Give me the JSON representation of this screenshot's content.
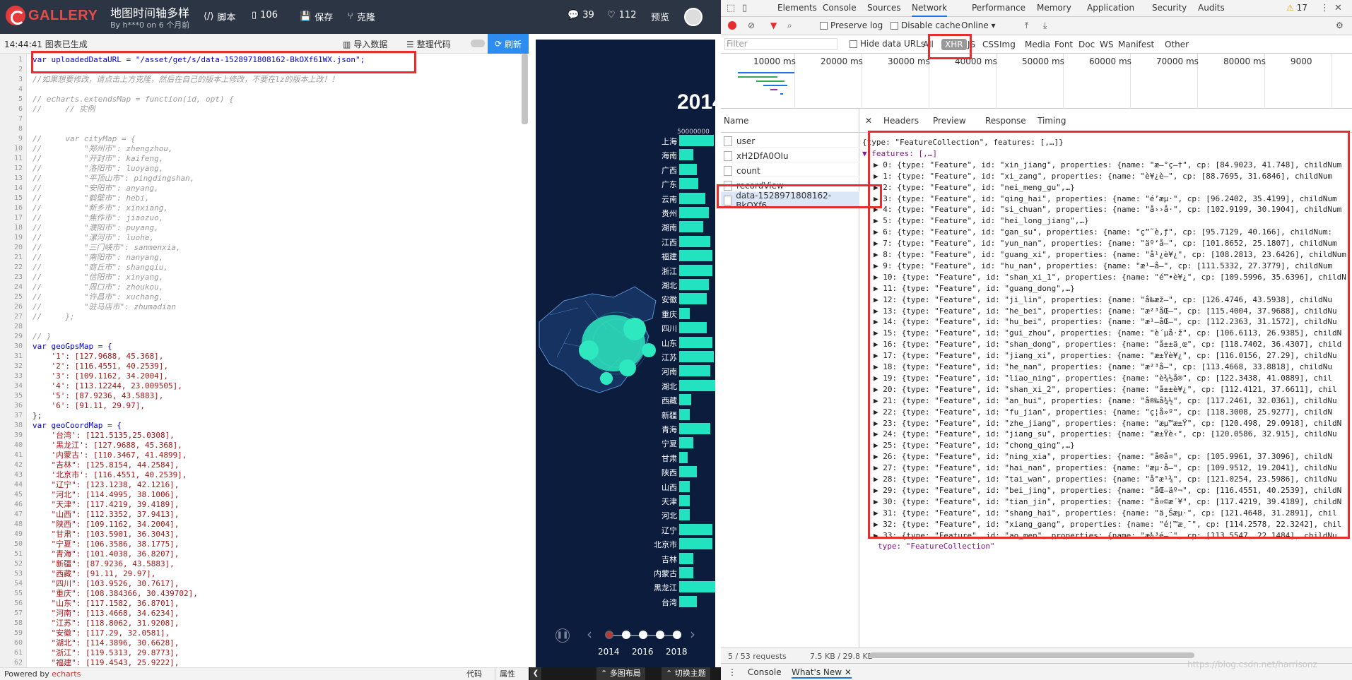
{
  "gallery": {
    "logo_text": "GALLERY",
    "page_title": "地图时间轴多样",
    "author": "By h***0 on 6 个月前",
    "script_btn": "脚本",
    "count_btn": "106",
    "save_btn": "保存",
    "clone_btn": "克隆",
    "comments": "39",
    "likes": "112",
    "preview_btn": "预览",
    "status": "14:44:41   图表已生成",
    "import_btn": "导入数据",
    "format_btn": "整理代码",
    "refresh_btn": "刷新",
    "footer_powered": "Powered by ",
    "footer_lib": "echarts",
    "tab_code": "代码",
    "tab_attr": "属性",
    "layout_btn": "多图布局",
    "theme_btn": "切换主题"
  },
  "code_lines": [
    {
      "n": "1",
      "t": "var uploadedDataURL = \"/asset/get/s/data-1528971808162-BkOXf61WX.json\";",
      "c": "kw"
    },
    {
      "n": "2",
      "t": "",
      "c": ""
    },
    {
      "n": "3",
      "t": "//如果想要修改，请点击上方克隆，然后在自己的版本上修改，不要在lz的版本上改！！",
      "c": "cm"
    },
    {
      "n": "4",
      "t": "",
      "c": ""
    },
    {
      "n": "5",
      "t": "// echarts.extendsMap = function(id, opt) {",
      "c": "cm"
    },
    {
      "n": "6",
      "t": "//     // 实例",
      "c": "cm"
    },
    {
      "n": "7",
      "t": "",
      "c": ""
    },
    {
      "n": "8",
      "t": "",
      "c": ""
    },
    {
      "n": "9",
      "t": "//     var cityMap = {",
      "c": "cm"
    },
    {
      "n": "10",
      "t": "//         \"郑州市\": zhengzhou,",
      "c": "cm"
    },
    {
      "n": "11",
      "t": "//         \"开封市\": kaifeng,",
      "c": "cm"
    },
    {
      "n": "12",
      "t": "//         \"洛阳市\": luoyang,",
      "c": "cm"
    },
    {
      "n": "13",
      "t": "//         \"平顶山市\": pingdingshan,",
      "c": "cm"
    },
    {
      "n": "14",
      "t": "//         \"安阳市\": anyang,",
      "c": "cm"
    },
    {
      "n": "15",
      "t": "//         \"鹤壁市\": hebi,",
      "c": "cm"
    },
    {
      "n": "16",
      "t": "//         \"新乡市\": xinxiang,",
      "c": "cm"
    },
    {
      "n": "17",
      "t": "//         \"焦作市\": jiaozuo,",
      "c": "cm"
    },
    {
      "n": "18",
      "t": "//         \"濮阳市\": puyang,",
      "c": "cm"
    },
    {
      "n": "19",
      "t": "//         \"漯河市\": luohe,",
      "c": "cm"
    },
    {
      "n": "20",
      "t": "//         \"三门峡市\": sanmenxia,",
      "c": "cm"
    },
    {
      "n": "21",
      "t": "//         \"南阳市\": nanyang,",
      "c": "cm"
    },
    {
      "n": "22",
      "t": "//         \"商丘市\": shangqiu,",
      "c": "cm"
    },
    {
      "n": "23",
      "t": "//         \"信阳市\": xinyang,",
      "c": "cm"
    },
    {
      "n": "24",
      "t": "//         \"周口市\": zhoukou,",
      "c": "cm"
    },
    {
      "n": "25",
      "t": "//         \"许昌市\": xuchang,",
      "c": "cm"
    },
    {
      "n": "26",
      "t": "//         \"驻马店市\": zhumadian",
      "c": "cm"
    },
    {
      "n": "27",
      "t": "//     };",
      "c": "cm"
    },
    {
      "n": "28",
      "t": "",
      "c": ""
    },
    {
      "n": "29",
      "t": "// }",
      "c": "cm"
    },
    {
      "n": "30",
      "t": "var geoGpsMap = {",
      "c": "kw"
    },
    {
      "n": "31",
      "t": "    '1': [127.9688, 45.368],",
      "c": "str"
    },
    {
      "n": "32",
      "t": "    '2': [116.4551, 40.2539],",
      "c": "str"
    },
    {
      "n": "33",
      "t": "    '3': [109.1162, 34.2004],",
      "c": "str"
    },
    {
      "n": "34",
      "t": "    '4': [113.12244, 23.009505],",
      "c": "str"
    },
    {
      "n": "35",
      "t": "    '5': [87.9236, 43.5883],",
      "c": "str"
    },
    {
      "n": "36",
      "t": "    '6': [91.11, 29.97],",
      "c": "str"
    },
    {
      "n": "37",
      "t": "};",
      "c": ""
    },
    {
      "n": "38",
      "t": "var geoCoordMap = {",
      "c": "kw"
    },
    {
      "n": "39",
      "t": "    '台湾': [121.5135,25.0308],",
      "c": "str"
    },
    {
      "n": "40",
      "t": "    '黑龙江': [127.9688, 45.368],",
      "c": "str"
    },
    {
      "n": "41",
      "t": "    '内蒙古': [110.3467, 41.4899],",
      "c": "str"
    },
    {
      "n": "42",
      "t": "    \"吉林\": [125.8154, 44.2584],",
      "c": "str"
    },
    {
      "n": "43",
      "t": "    '北京市': [116.4551, 40.2539],",
      "c": "str"
    },
    {
      "n": "44",
      "t": "    \"辽宁\": [123.1238, 42.1216],",
      "c": "str"
    },
    {
      "n": "45",
      "t": "    \"河北\": [114.4995, 38.1006],",
      "c": "str"
    },
    {
      "n": "46",
      "t": "    \"天津\": [117.4219, 39.4189],",
      "c": "str"
    },
    {
      "n": "47",
      "t": "    \"山西\": [112.3352, 37.9413],",
      "c": "str"
    },
    {
      "n": "48",
      "t": "    \"陕西\": [109.1162, 34.2004],",
      "c": "str"
    },
    {
      "n": "49",
      "t": "    \"甘肃\": [103.5901, 36.3043],",
      "c": "str"
    },
    {
      "n": "50",
      "t": "    \"宁夏\": [106.3586, 38.1775],",
      "c": "str"
    },
    {
      "n": "51",
      "t": "    \"青海\": [101.4038, 36.8207],",
      "c": "str"
    },
    {
      "n": "52",
      "t": "    \"新疆\": [87.9236, 43.5883],",
      "c": "str"
    },
    {
      "n": "53",
      "t": "    \"西藏\": [91.11, 29.97],",
      "c": "str"
    },
    {
      "n": "54",
      "t": "    \"四川\": [103.9526, 30.7617],",
      "c": "str"
    },
    {
      "n": "55",
      "t": "    \"重庆\": [108.384366, 30.439702],",
      "c": "str"
    },
    {
      "n": "56",
      "t": "    \"山东\": [117.1582, 36.8701],",
      "c": "str"
    },
    {
      "n": "57",
      "t": "    \"河南\": [113.4668, 34.6234],",
      "c": "str"
    },
    {
      "n": "58",
      "t": "    \"江苏\": [118.8062, 31.9208],",
      "c": "str"
    },
    {
      "n": "59",
      "t": "    \"安徽\": [117.29, 32.0581],",
      "c": "str"
    },
    {
      "n": "60",
      "t": "    \"湖北\": [114.3896, 30.6628],",
      "c": "str"
    },
    {
      "n": "61",
      "t": "    \"浙江\": [119.5313, 29.8773],",
      "c": "str"
    },
    {
      "n": "62",
      "t": "    \"福建\": [119.4543, 25.9222],",
      "c": "str"
    }
  ],
  "chart": {
    "year": "2014",
    "scale": "50000000",
    "bars": [
      {
        "name": "上海",
        "value": 100
      },
      {
        "name": "海南",
        "value": 40
      },
      {
        "name": "广西",
        "value": 50
      },
      {
        "name": "广东",
        "value": 55
      },
      {
        "name": "云南",
        "value": 75
      },
      {
        "name": "贵州",
        "value": 85
      },
      {
        "name": "湖南",
        "value": 70
      },
      {
        "name": "江西",
        "value": 90
      },
      {
        "name": "福建",
        "value": 95
      },
      {
        "name": "浙江",
        "value": 95
      },
      {
        "name": "湖北",
        "value": 85
      },
      {
        "name": "安徽",
        "value": 80
      },
      {
        "name": "重庆",
        "value": 30
      },
      {
        "name": "四川",
        "value": 80
      },
      {
        "name": "山东",
        "value": 95
      },
      {
        "name": "江苏",
        "value": 100
      },
      {
        "name": "河南",
        "value": 90
      },
      {
        "name": "湖北2",
        "value": 105
      },
      {
        "name": "西藏",
        "value": 35
      },
      {
        "name": "新疆",
        "value": 30
      },
      {
        "name": "青海",
        "value": 90
      },
      {
        "name": "宁夏",
        "value": 40
      },
      {
        "name": "甘肃",
        "value": 25
      },
      {
        "name": "陕西",
        "value": 50
      },
      {
        "name": "山西",
        "value": 30
      },
      {
        "name": "天津",
        "value": 30
      },
      {
        "name": "河北",
        "value": 30
      },
      {
        "name": "辽宁",
        "value": 95
      },
      {
        "name": "北京市",
        "value": 95
      },
      {
        "name": "吉林",
        "value": 40
      },
      {
        "name": "内蒙古",
        "value": 40
      },
      {
        "name": "黑龙江",
        "value": 105
      },
      {
        "name": "台湾",
        "value": 50
      }
    ],
    "timeline_years": [
      "2014",
      "2016",
      "2018"
    ],
    "bar_color": "#22e3c0"
  },
  "devtools": {
    "tabs": [
      "Elements",
      "Console",
      "Sources",
      "Network",
      "Performance",
      "Memory",
      "Application",
      "Security",
      "Audits"
    ],
    "warn": "17",
    "preserve_log": "Preserve log",
    "disable_cache": "Disable cache",
    "online": "Online",
    "filter_placeholder": "Filter",
    "hide_data_urls": "Hide data URLs",
    "filter_types": [
      "All",
      "XHR",
      "JS",
      "CSS",
      "Img",
      "Media",
      "Font",
      "Doc",
      "WS",
      "Manifest",
      "Other"
    ],
    "timeline_ticks": [
      "10000 ms",
      "20000 ms",
      "30000 ms",
      "40000 ms",
      "50000 ms",
      "60000 ms",
      "70000 ms",
      "80000 ms",
      "9000"
    ],
    "name_header": "Name",
    "requests": [
      "user",
      "xH2DfA0OIu",
      "count",
      "recordView",
      "data-1528971808162-BkOXf6..."
    ],
    "preview_tabs": [
      "Headers",
      "Preview",
      "Response",
      "Timing"
    ],
    "status": "5 / 53 requests",
    "size": "7.5 KB / 29.8 KB",
    "drawer_console": "Console",
    "drawer_whatsnew": "What's New",
    "watermark": "https://blog.csdn.net/harrisonz"
  },
  "json_lines": [
    "{type: \"FeatureCollection\", features: [,…]}",
    "▼ features: [,…]",
    "▶ 0: {type: \"Feature\", id: \"xin_jiang\", properties: {name: \"æ–°ç–†\", cp: [84.9023, 41.748], childNum",
    "▶ 1: {type: \"Feature\", id: \"xi_zang\", properties: {name: \"è¥¿è—\", cp: [88.7695, 31.6846], childNum",
    "▶ 2: {type: \"Feature\", id: \"nei_meng_gu\",…}",
    "▶ 3: {type: \"Feature\", id: \"qing_hai\", properties: {name: \"é’æµ·\", cp: [96.2402, 35.4199], childNum",
    "▶ 4: {type: \"Feature\", id: \"si_chuan\", properties: {name: \"å››å·\", cp: [102.9199, 30.1904], childNum",
    "▶ 5: {type: \"Feature\", id: \"hei_long_jiang\",…}",
    "▶ 6: {type: \"Feature\", id: \"gan_su\", properties: {name: \"ç”˜è‚ƒ\", cp: [95.7129, 40.166], childNum:",
    "▶ 7: {type: \"Feature\", id: \"yun_nan\", properties: {name: \"äº‘å—\", cp: [101.8652, 25.1807], childNum",
    "▶ 8: {type: \"Feature\", id: \"guang_xi\", properties: {name: \"å¹¿è¥¿\", cp: [108.2813, 23.6426], childNum",
    "▶ 9: {type: \"Feature\", id: \"hu_nan\", properties: {name: \"æ¹–å—\", cp: [111.5332, 27.3779], childNum",
    "▶ 10: {type: \"Feature\", id: \"shan_xi_1\", properties: {name: \"é™•è¥¿\", cp: [109.5996, 35.6396], childN",
    "▶ 11: {type: \"Feature\", id: \"guang_dong\",…}",
    "▶ 12: {type: \"Feature\", id: \"ji_lin\", properties: {name: \"å‰æž—\", cp: [126.4746, 43.5938], childNu",
    "▶ 13: {type: \"Feature\", id: \"he_bei\", properties: {name: \"æ²³åŒ—\", cp: [115.4004, 37.9688], childNu",
    "▶ 14: {type: \"Feature\", id: \"hu_bei\", properties: {name: \"æ¹–åŒ—\", cp: [112.2363, 31.1572], childNu",
    "▶ 15: {type: \"Feature\", id: \"gui_zhou\", properties: {name: \"è´µå·ž\", cp: [106.6113, 26.9385], childN",
    "▶ 16: {type: \"Feature\", id: \"shan_dong\", properties: {name: \"å±±ä¸œ\", cp: [118.7402, 36.4307], child",
    "▶ 17: {type: \"Feature\", id: \"jiang_xi\", properties: {name: \"æ±Ÿè¥¿\", cp: [116.0156, 27.29], childNu",
    "▶ 18: {type: \"Feature\", id: \"he_nan\", properties: {name: \"æ²³å—\", cp: [113.4668, 33.8818], childNu",
    "▶ 19: {type: \"Feature\", id: \"liao_ning\", properties: {name: \"è¾½å®\", cp: [122.3438, 41.0889], chil",
    "▶ 20: {type: \"Feature\", id: \"shan_xi_2\", properties: {name: \"å±±è¥¿\", cp: [112.4121, 37.6611], chil",
    "▶ 21: {type: \"Feature\", id: \"an_hui\", properties: {name: \"å®‰å¾½\", cp: [117.2461, 32.0361], childNu",
    "▶ 22: {type: \"Feature\", id: \"fu_jian\", properties: {name: \"ç¦å»º\", cp: [118.3008, 25.9277], childN",
    "▶ 23: {type: \"Feature\", id: \"zhe_jiang\", properties: {name: \"æµ™æ±Ÿ\", cp: [120.498, 29.0918], childN",
    "▶ 24: {type: \"Feature\", id: \"jiang_su\", properties: {name: \"æ±Ÿè‹\", cp: [120.0586, 32.915], childNu",
    "▶ 25: {type: \"Feature\", id: \"chong_qing\",…}",
    "▶ 26: {type: \"Feature\", id: \"ning_xia\", properties: {name: \"å®å¤\", cp: [105.9961, 37.3096], childN",
    "▶ 27: {type: \"Feature\", id: \"hai_nan\", properties: {name: \"æµ·å—\", cp: [109.9512, 19.2041], childNu",
    "▶ 28: {type: \"Feature\", id: \"tai_wan\", properties: {name: \"å°æ¹¾\", cp: [121.0254, 23.5986], childNu",
    "▶ 29: {type: \"Feature\", id: \"bei_jing\", properties: {name: \"åŒ—äº¬\", cp: [116.4551, 40.2539], childN",
    "▶ 30: {type: \"Feature\", id: \"tian_jin\", properties: {name: \"å¤©æ´¥\", cp: [117.4219, 39.4189], childN",
    "▶ 31: {type: \"Feature\", id: \"shang_hai\", properties: {name: \"ä¸Šæµ·\", cp: [121.4648, 31.2891], chil",
    "▶ 32: {type: \"Feature\", id: \"xiang_gang\", properties: {name: \"é¦™æ¸¯\", cp: [114.2578, 22.3242], chil",
    "▶ 33: {type: \"Feature\", id: \"ao_men\", properties: {name: \"æ¾³é—¨\", cp: [113.5547, 22.1484], childNu",
    "  type: \"FeatureCollection\""
  ]
}
